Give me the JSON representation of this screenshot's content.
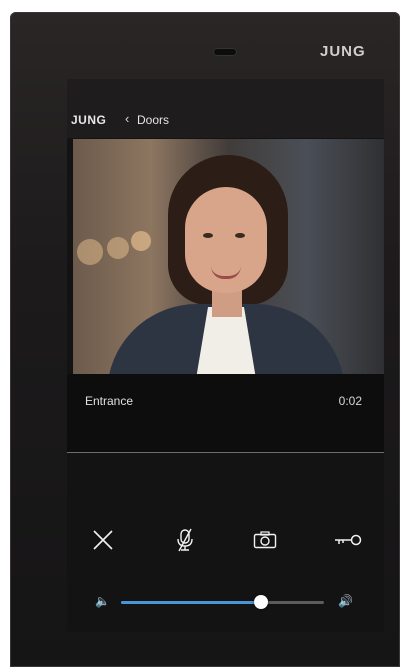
{
  "device": {
    "brand": "JUNG"
  },
  "header": {
    "logo_text": "JUNG",
    "back_glyph": "‹",
    "title": "Doors"
  },
  "call": {
    "location": "Entrance",
    "duration": "0:02"
  },
  "controls": {
    "icons": [
      "close-icon",
      "mic-muted-icon",
      "camera-icon",
      "key-icon"
    ]
  },
  "volume": {
    "level": 0.69,
    "accent_color": "#4a95d4",
    "icon_low": "🔈",
    "icon_high": "🔊"
  }
}
